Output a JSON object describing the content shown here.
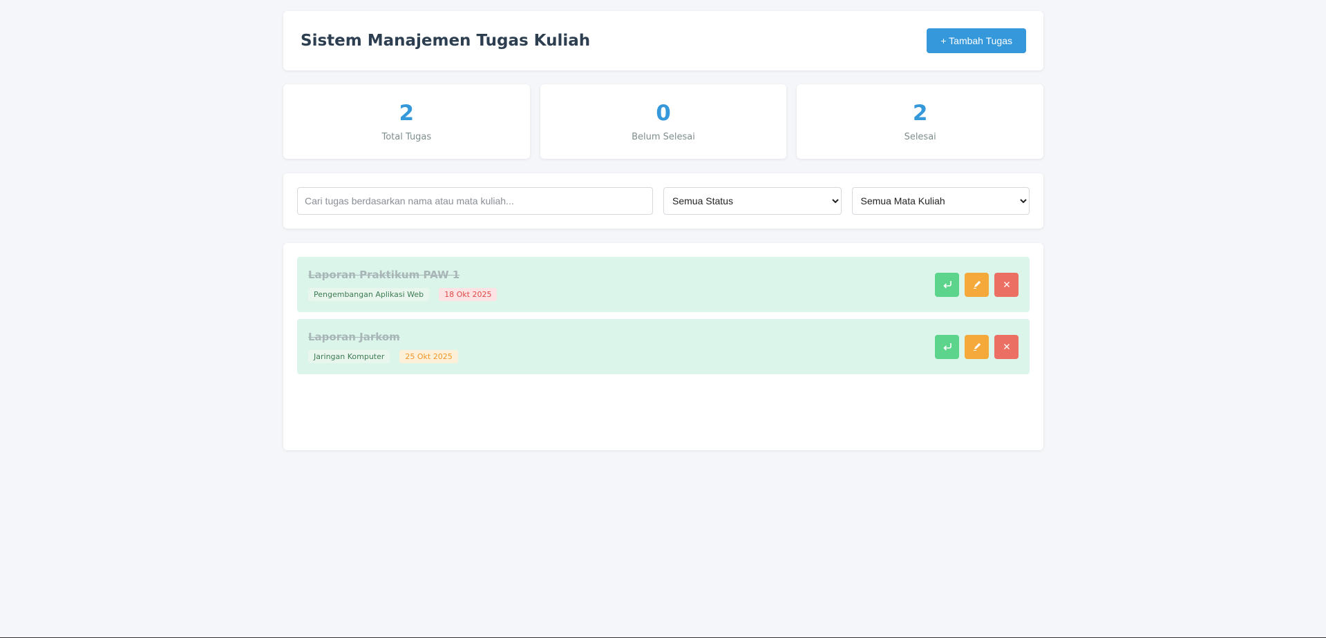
{
  "header": {
    "title": "Sistem Manajemen Tugas Kuliah",
    "add_label": "+ Tambah Tugas"
  },
  "stats": [
    {
      "value": "2",
      "label": "Total Tugas"
    },
    {
      "value": "0",
      "label": "Belum Selesai"
    },
    {
      "value": "2",
      "label": "Selesai"
    }
  ],
  "filters": {
    "search_placeholder": "Cari tugas berdasarkan nama atau mata kuliah...",
    "status_selected": "Semua Status",
    "course_selected": "Semua Mata Kuliah"
  },
  "tasks": [
    {
      "name": "Laporan Praktikum PAW 1",
      "course": "Pengembangan Aplikasi Web",
      "date": "18 Okt 2025",
      "date_color": "#e04848"
    },
    {
      "name": "Laporan Jarkom",
      "course": "Jaringan Komputer",
      "date": "25 Okt 2025",
      "date_color": "#f0962a"
    }
  ],
  "icons": {
    "undo": "undo-icon",
    "edit": "pencil-icon",
    "delete": "close-icon"
  },
  "colors": {
    "accent": "#3498db",
    "undo": "#5dd48c",
    "edit": "#f5a93a",
    "delete": "#ec6f63",
    "done_row": "#dcf5ea"
  }
}
